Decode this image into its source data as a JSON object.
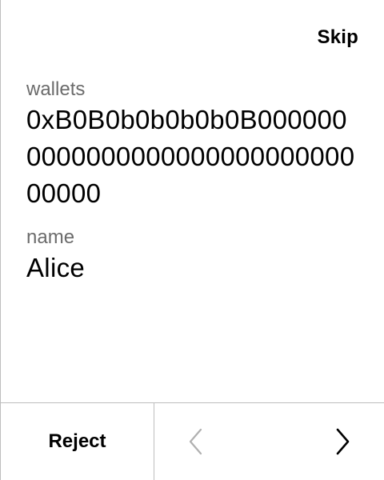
{
  "header": {
    "skip_label": "Skip"
  },
  "fields": {
    "wallets": {
      "label": "wallets",
      "value": "0xB0B0b0b0b0b0B000000000000000000000000000000000"
    },
    "name": {
      "label": "name",
      "value": "Alice"
    }
  },
  "footer": {
    "reject_label": "Reject",
    "prev_icon": "chevron-left-icon",
    "next_icon": "chevron-right-icon",
    "prev_disabled": true
  },
  "colors": {
    "text": "#000000",
    "label": "#6b6b6b",
    "divider": "#bdbdbd",
    "disabled_icon": "#b0b0b0"
  }
}
